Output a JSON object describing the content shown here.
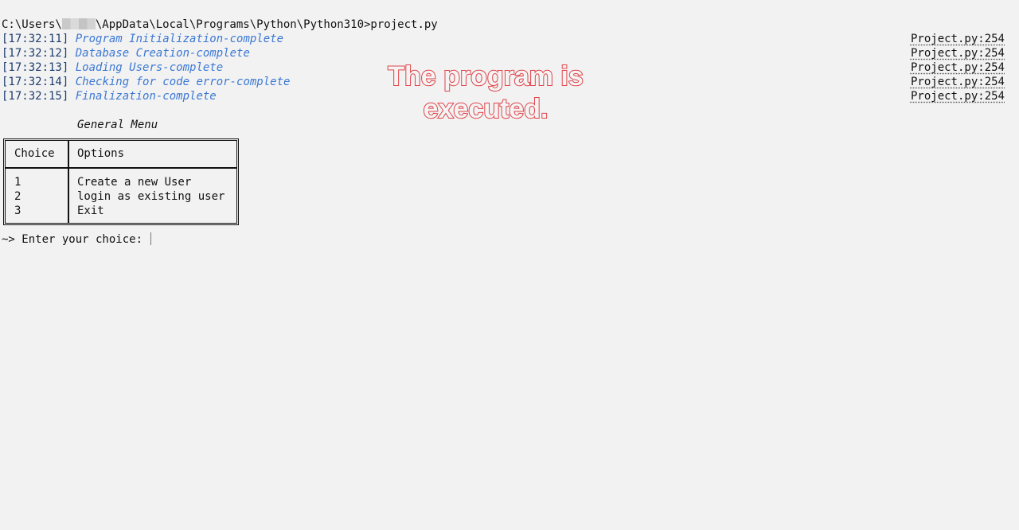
{
  "terminal": {
    "command_prefix": "C:\\Users\\",
    "command_suffix": "\\AppData\\Local\\Programs\\Python\\Python310>project.py",
    "log": [
      {
        "time": "[17:32:11]",
        "message": "Program Initialization-complete",
        "source": "Project.py:254"
      },
      {
        "time": "[17:32:12]",
        "message": "Database Creation-complete",
        "source": "Project.py:254"
      },
      {
        "time": "[17:32:13]",
        "message": "Loading Users-complete",
        "source": "Project.py:254"
      },
      {
        "time": "[17:32:14]",
        "message": "Checking for code error-complete",
        "source": "Project.py:254"
      },
      {
        "time": "[17:32:15]",
        "message": "Finalization-complete",
        "source": "Project.py:254"
      }
    ],
    "menu": {
      "title": "General Menu",
      "headers": [
        "Choice",
        "Options"
      ],
      "rows": [
        {
          "choice": "1",
          "option": "Create a new User"
        },
        {
          "choice": "2",
          "option": "login as existing user"
        },
        {
          "choice": "3",
          "option": "Exit"
        }
      ]
    },
    "prompt": "~> Enter your choice: "
  },
  "annotation": {
    "line1": "The program is",
    "line2": "executed.",
    "color": "#e0444a"
  },
  "colors": {
    "background": "#f2f2f2",
    "timestamp": "#1e3d6e",
    "message": "#3b78d4",
    "text": "#111111"
  }
}
